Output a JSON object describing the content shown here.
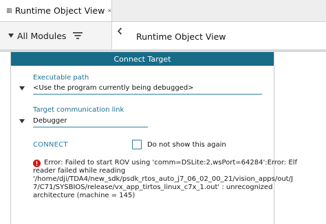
{
  "tab": {
    "title": "Runtime Object View",
    "icon": "grid-icon",
    "close_icon": "close-icon"
  },
  "modules": {
    "label": "All Modules",
    "filter_icon": "filter-icon"
  },
  "view_header": {
    "title": "Runtime Object View"
  },
  "connect_panel": {
    "header": "Connect Target",
    "executable_path": {
      "label": "Executable path",
      "value": "<Use the program currently being debugged>"
    },
    "communication_link": {
      "label": "Target communication link",
      "value": "Debugger"
    },
    "connect_label": "CONNECT",
    "dont_show_label": "Do not show this again",
    "dont_show_checked": false,
    "error": {
      "lines": [
        "Error: Failed to start ROV using 'comm=DSLite:2,wsPort=64284':Error: Elf",
        "reader failed while reading",
        "'/home/dji/TDA4/new_sdk/psdk_rtos_auto_j7_06_02_00_21/vision_apps/out/J",
        "7/C71/SYSBIOS/release/vx_app_tirtos_linux_c7x_1.out' : unrecognized",
        "architecture (machine = 145)"
      ]
    }
  },
  "colors": {
    "panel_header": "#176c87",
    "link": "#1e7fa8",
    "error": "#d21414"
  }
}
